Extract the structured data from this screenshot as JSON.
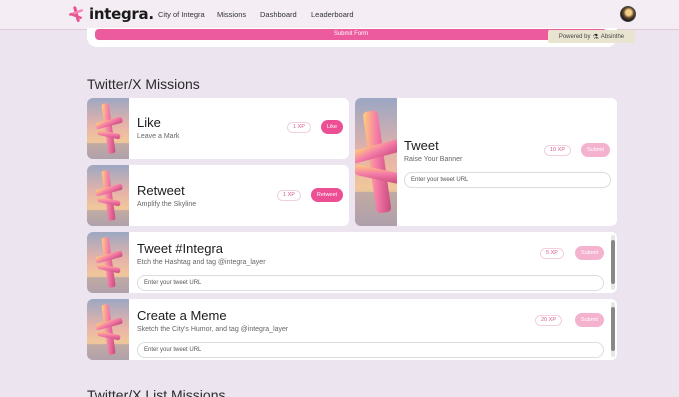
{
  "nav": {
    "logo_text": "integra.",
    "links": [
      "City of Integra",
      "Missions",
      "Dashboard",
      "Leaderboard"
    ]
  },
  "form": {
    "submit_label": "Submit Form",
    "powered_label": "Powered by",
    "powered_brand": "Absinthe"
  },
  "sections": {
    "twitter_missions": "Twitter/X Missions",
    "twitter_list_missions": "Twitter/X List Missions"
  },
  "missions": {
    "like": {
      "title": "Like",
      "subtitle": "Leave a Mark",
      "xp": "1 XP",
      "button": "Like"
    },
    "retweet": {
      "title": "Retweet",
      "subtitle": "Amplify the Skyline",
      "xp": "1 XP",
      "button": "Retweet"
    },
    "tweet": {
      "title": "Tweet",
      "subtitle": "Raise Your Banner",
      "xp": "10 XP",
      "button": "Submit",
      "placeholder": "Enter your tweet URL"
    },
    "hashtag": {
      "title": "Tweet #Integra",
      "subtitle": "Etch the Hashtag and tag @integra_layer",
      "xp": "5 XP",
      "button": "Submit",
      "placeholder": "Enter your tweet URL"
    },
    "meme": {
      "title": "Create a Meme",
      "subtitle": "Sketch the City's Humor, and tag @integra_layer",
      "xp": "20 XP",
      "button": "Submit",
      "placeholder": "Enter your tweet URL"
    }
  },
  "colors": {
    "accent": "#ec4f93",
    "accent_muted": "#f4b2cf",
    "background": "#ece4ef"
  },
  "icons": [
    "integra-logo-icon",
    "absinthe-logo-icon",
    "user-avatar"
  ]
}
